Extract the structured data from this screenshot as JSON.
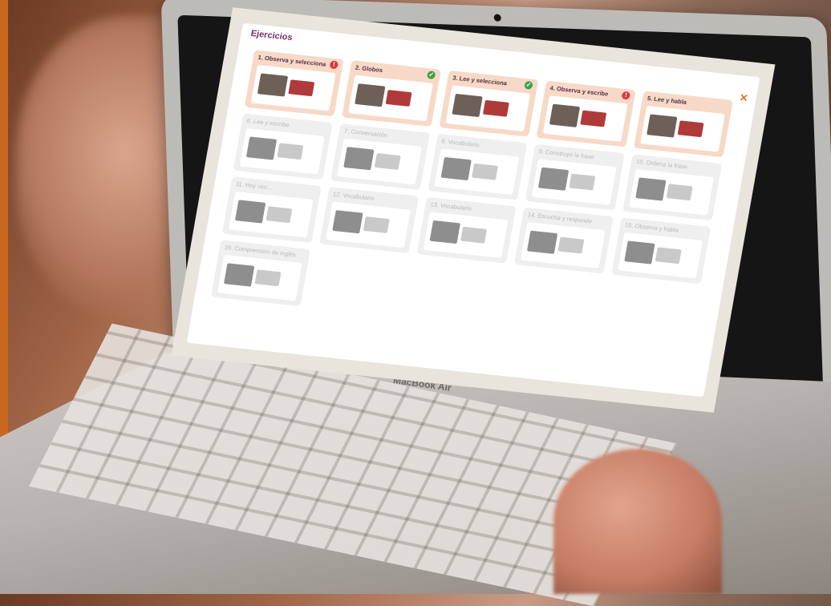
{
  "screen": {
    "header": "Ejercicios",
    "close_icon": "close-icon",
    "cards": [
      {
        "title": "1. Observa y selecciona",
        "state": "active",
        "status": "err"
      },
      {
        "title": "2. Globos",
        "state": "active",
        "status": "ok"
      },
      {
        "title": "3. Lee y selecciona",
        "state": "active",
        "status": "ok"
      },
      {
        "title": "4. Observa y escribe",
        "state": "active",
        "status": "err"
      },
      {
        "title": "5. Lee y habla",
        "state": "active",
        "status": ""
      },
      {
        "title": "6. Lee y escribe",
        "state": "inactive",
        "status": ""
      },
      {
        "title": "7. Conversación",
        "state": "inactive",
        "status": ""
      },
      {
        "title": "8. Vocabulario",
        "state": "inactive",
        "status": ""
      },
      {
        "title": "9. Construye la frase",
        "state": "inactive",
        "status": ""
      },
      {
        "title": "10. Ordena la frase",
        "state": "inactive",
        "status": ""
      },
      {
        "title": "11. Hoy veo...",
        "state": "inactive",
        "status": ""
      },
      {
        "title": "12. Vocabulario",
        "state": "inactive",
        "status": ""
      },
      {
        "title": "13. Vocabulario",
        "state": "inactive",
        "status": ""
      },
      {
        "title": "14. Escucha y responde",
        "state": "inactive",
        "status": ""
      },
      {
        "title": "15. Observa y habla",
        "state": "inactive",
        "status": ""
      },
      {
        "title": "16. Comprensión de inglés",
        "state": "inactive",
        "status": ""
      }
    ]
  },
  "device": {
    "brand": "MacBook Air"
  },
  "colors": {
    "accent": "#e07a22",
    "header_text": "#7a2b6e",
    "active_card": "#f7d9c7",
    "ok": "#3aa54a",
    "err": "#d8393d"
  }
}
